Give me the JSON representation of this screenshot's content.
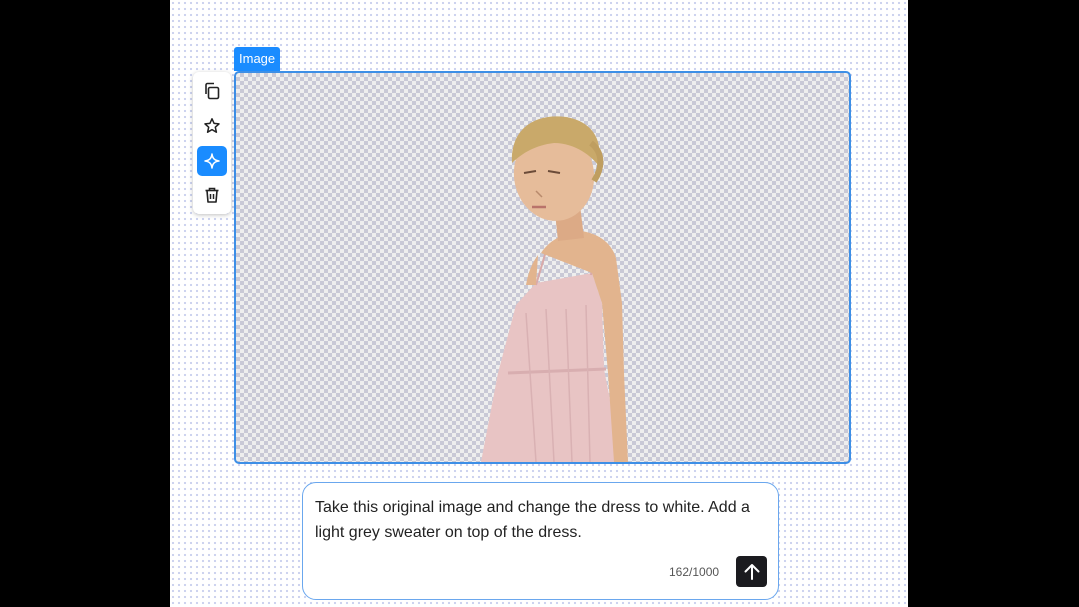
{
  "canvas": {
    "image_block": {
      "label": "Image",
      "image_alt": "Woman in a light pink sleeveless dress with blonde hair tied back, on a transparent background"
    },
    "toolbar": {
      "items": [
        {
          "icon": "copy-icon"
        },
        {
          "icon": "star-icon"
        },
        {
          "icon": "sparkle-icon",
          "active": true
        },
        {
          "icon": "trash-icon"
        }
      ]
    }
  },
  "prompt": {
    "text": "Take this original image and change the dress to white. Add a light grey sweater on top of the dress.",
    "counter": "162/1000",
    "send_icon": "arrow-up-icon"
  },
  "colors": {
    "accent": "#1a8cff",
    "frame_border": "#3d8fe6",
    "send_button": "#1b1b1f"
  }
}
